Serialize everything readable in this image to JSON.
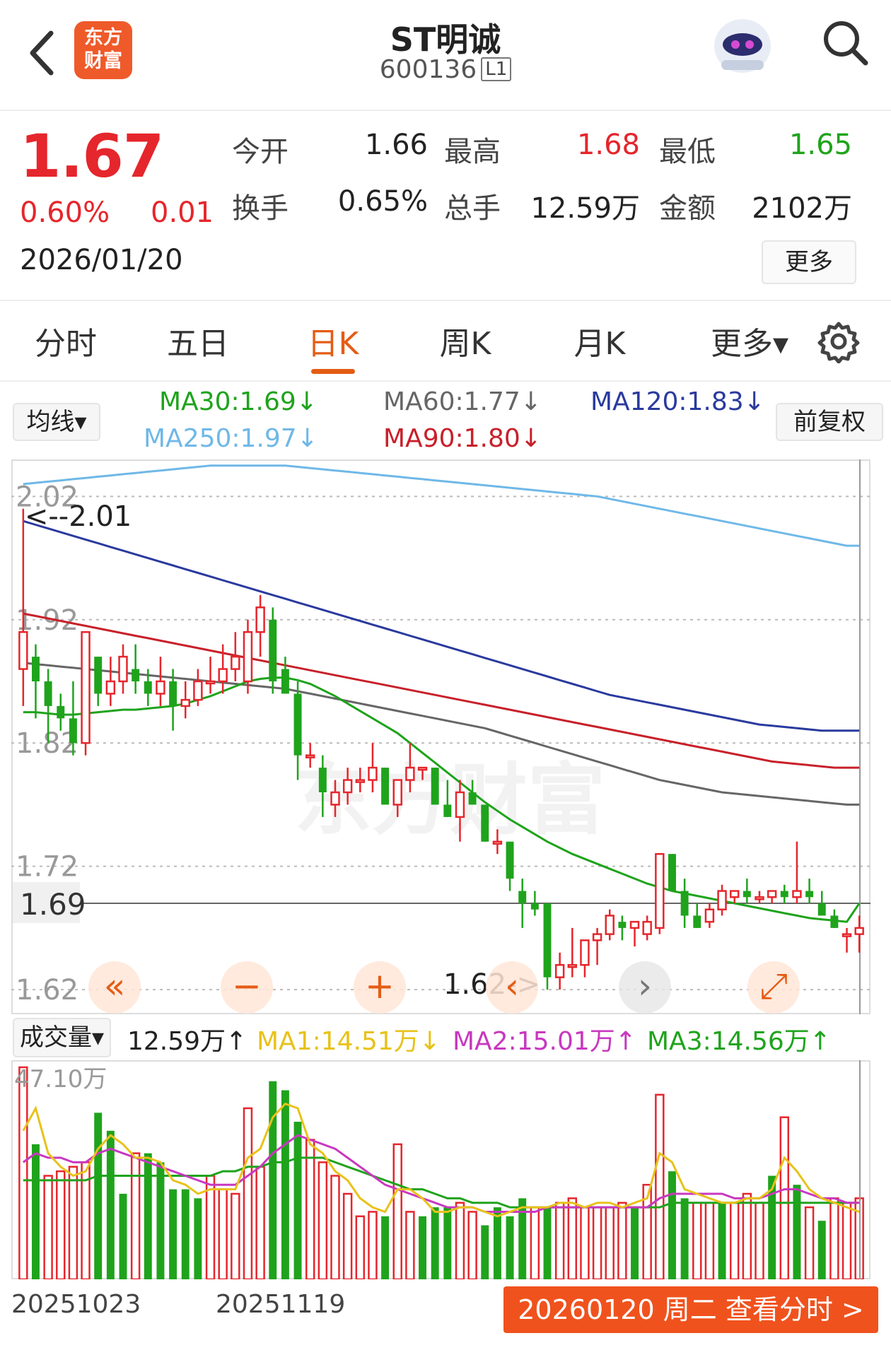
{
  "header": {
    "logo_text_line1": "东方",
    "logo_text_line2": "财富",
    "stock_name": "ST明诚",
    "stock_code": "600136",
    "level_badge": "L1"
  },
  "quote": {
    "price": "1.67",
    "change_pct": "0.60%",
    "change": "0.01",
    "date": "2026/01/20",
    "open_label": "今开",
    "open": "1.66",
    "high_label": "最高",
    "high": "1.68",
    "low_label": "最低",
    "low": "1.65",
    "turnover_label": "换手",
    "turnover": "0.65%",
    "volume_label": "总手",
    "volume": "12.59万",
    "amount_label": "金额",
    "amount": "2102万",
    "more_label": "更多"
  },
  "tabs": [
    {
      "label": "分时"
    },
    {
      "label": "五日"
    },
    {
      "label": "日K"
    },
    {
      "label": "周K"
    },
    {
      "label": "月K"
    },
    {
      "label": "更多▾"
    }
  ],
  "active_tab": "日K",
  "ma_legend": {
    "select_label": "均线▾",
    "adjust_label": "前复权",
    "ma30": "MA30:1.69↓",
    "ma60": "MA60:1.77↓",
    "ma120": "MA120:1.83↓",
    "ma250": "MA250:1.97↓",
    "ma90": "MA90:1.80↓"
  },
  "colors": {
    "up": "#e5262c",
    "down": "#1fa31c",
    "ma30": "#1fa31c",
    "ma60": "#666666",
    "ma120": "#2a3a9e",
    "ma250": "#6fb8e8",
    "ma90": "#c8202a",
    "vma1": "#e8c21a",
    "vma2": "#c838c0",
    "vma3": "#1fa31c",
    "accent": "#e45c15"
  },
  "kline_axis": {
    "ticks": [
      "2.02",
      "1.92",
      "1.82",
      "1.72",
      "1.62"
    ],
    "current_price_label": "1.69",
    "max_marker": "<--2.01",
    "min_marker": "1.62->"
  },
  "controls": [
    "«",
    "−",
    "+",
    "‹",
    "›",
    "⤢"
  ],
  "volume_legend": {
    "select_label": "成交量▾",
    "current": "12.59万↑",
    "ma1": "MA1:14.51万↓",
    "ma2": "MA2:15.01万↑",
    "ma3": "MA3:14.56万↑",
    "max_label": "47.10万"
  },
  "x_dates": [
    "20251023",
    "20251119"
  ],
  "fenshi_button": "20260120 周二 查看分时 >",
  "chart_data": {
    "type": "candlestick",
    "ylim": [
      1.6,
      2.05
    ],
    "candles": [
      {
        "o": 1.88,
        "h": 2.01,
        "l": 1.85,
        "c": 1.91
      },
      {
        "o": 1.89,
        "h": 1.9,
        "l": 1.84,
        "c": 1.87
      },
      {
        "o": 1.87,
        "h": 1.88,
        "l": 1.82,
        "c": 1.85
      },
      {
        "o": 1.85,
        "h": 1.86,
        "l": 1.83,
        "c": 1.84
      },
      {
        "o": 1.84,
        "h": 1.87,
        "l": 1.81,
        "c": 1.82
      },
      {
        "o": 1.82,
        "h": 1.91,
        "l": 1.81,
        "c": 1.91
      },
      {
        "o": 1.89,
        "h": 1.89,
        "l": 1.85,
        "c": 1.86
      },
      {
        "o": 1.86,
        "h": 1.89,
        "l": 1.85,
        "c": 1.87
      },
      {
        "o": 1.87,
        "h": 1.9,
        "l": 1.86,
        "c": 1.89
      },
      {
        "o": 1.88,
        "h": 1.9,
        "l": 1.86,
        "c": 1.87
      },
      {
        "o": 1.87,
        "h": 1.88,
        "l": 1.85,
        "c": 1.86
      },
      {
        "o": 1.86,
        "h": 1.89,
        "l": 1.85,
        "c": 1.87
      },
      {
        "o": 1.87,
        "h": 1.88,
        "l": 1.83,
        "c": 1.85
      },
      {
        "o": 1.85,
        "h": 1.87,
        "l": 1.84,
        "c": 1.855
      },
      {
        "o": 1.855,
        "h": 1.88,
        "l": 1.85,
        "c": 1.87
      },
      {
        "o": 1.87,
        "h": 1.89,
        "l": 1.86,
        "c": 1.87
      },
      {
        "o": 1.87,
        "h": 1.9,
        "l": 1.86,
        "c": 1.88
      },
      {
        "o": 1.88,
        "h": 1.91,
        "l": 1.87,
        "c": 1.89
      },
      {
        "o": 1.87,
        "h": 1.92,
        "l": 1.86,
        "c": 1.91
      },
      {
        "o": 1.91,
        "h": 1.94,
        "l": 1.89,
        "c": 1.93
      },
      {
        "o": 1.92,
        "h": 1.93,
        "l": 1.86,
        "c": 1.87
      },
      {
        "o": 1.88,
        "h": 1.89,
        "l": 1.86,
        "c": 1.86
      },
      {
        "o": 1.86,
        "h": 1.87,
        "l": 1.79,
        "c": 1.81
      },
      {
        "o": 1.81,
        "h": 1.82,
        "l": 1.8,
        "c": 1.81
      },
      {
        "o": 1.8,
        "h": 1.81,
        "l": 1.76,
        "c": 1.78
      },
      {
        "o": 1.77,
        "h": 1.79,
        "l": 1.76,
        "c": 1.78
      },
      {
        "o": 1.78,
        "h": 1.8,
        "l": 1.77,
        "c": 1.79
      },
      {
        "o": 1.79,
        "h": 1.8,
        "l": 1.78,
        "c": 1.79
      },
      {
        "o": 1.79,
        "h": 1.82,
        "l": 1.78,
        "c": 1.8
      },
      {
        "o": 1.8,
        "h": 1.8,
        "l": 1.77,
        "c": 1.77
      },
      {
        "o": 1.77,
        "h": 1.79,
        "l": 1.76,
        "c": 1.79
      },
      {
        "o": 1.79,
        "h": 1.82,
        "l": 1.78,
        "c": 1.8
      },
      {
        "o": 1.8,
        "h": 1.8,
        "l": 1.79,
        "c": 1.8
      },
      {
        "o": 1.8,
        "h": 1.8,
        "l": 1.77,
        "c": 1.77
      },
      {
        "o": 1.77,
        "h": 1.79,
        "l": 1.76,
        "c": 1.76
      },
      {
        "o": 1.76,
        "h": 1.79,
        "l": 1.74,
        "c": 1.78
      },
      {
        "o": 1.78,
        "h": 1.79,
        "l": 1.77,
        "c": 1.77
      },
      {
        "o": 1.77,
        "h": 1.77,
        "l": 1.74,
        "c": 1.74
      },
      {
        "o": 1.74,
        "h": 1.75,
        "l": 1.73,
        "c": 1.74
      },
      {
        "o": 1.74,
        "h": 1.74,
        "l": 1.7,
        "c": 1.71
      },
      {
        "o": 1.7,
        "h": 1.71,
        "l": 1.67,
        "c": 1.69
      },
      {
        "o": 1.69,
        "h": 1.7,
        "l": 1.68,
        "c": 1.685
      },
      {
        "o": 1.69,
        "h": 1.69,
        "l": 1.62,
        "c": 1.63
      },
      {
        "o": 1.63,
        "h": 1.65,
        "l": 1.62,
        "c": 1.64
      },
      {
        "o": 1.64,
        "h": 1.67,
        "l": 1.63,
        "c": 1.64
      },
      {
        "o": 1.64,
        "h": 1.66,
        "l": 1.63,
        "c": 1.66
      },
      {
        "o": 1.66,
        "h": 1.67,
        "l": 1.64,
        "c": 1.665
      },
      {
        "o": 1.665,
        "h": 1.685,
        "l": 1.66,
        "c": 1.68
      },
      {
        "o": 1.675,
        "h": 1.68,
        "l": 1.66,
        "c": 1.67
      },
      {
        "o": 1.67,
        "h": 1.675,
        "l": 1.655,
        "c": 1.675
      },
      {
        "o": 1.665,
        "h": 1.68,
        "l": 1.66,
        "c": 1.675
      },
      {
        "o": 1.67,
        "h": 1.73,
        "l": 1.665,
        "c": 1.73
      },
      {
        "o": 1.73,
        "h": 1.73,
        "l": 1.7,
        "c": 1.7
      },
      {
        "o": 1.7,
        "h": 1.71,
        "l": 1.67,
        "c": 1.68
      },
      {
        "o": 1.68,
        "h": 1.69,
        "l": 1.67,
        "c": 1.67
      },
      {
        "o": 1.675,
        "h": 1.69,
        "l": 1.67,
        "c": 1.685
      },
      {
        "o": 1.685,
        "h": 1.705,
        "l": 1.68,
        "c": 1.7
      },
      {
        "o": 1.695,
        "h": 1.7,
        "l": 1.69,
        "c": 1.7
      },
      {
        "o": 1.7,
        "h": 1.71,
        "l": 1.69,
        "c": 1.695
      },
      {
        "o": 1.695,
        "h": 1.7,
        "l": 1.69,
        "c": 1.695
      },
      {
        "o": 1.695,
        "h": 1.7,
        "l": 1.69,
        "c": 1.7
      },
      {
        "o": 1.7,
        "h": 1.705,
        "l": 1.69,
        "c": 1.695
      },
      {
        "o": 1.695,
        "h": 1.74,
        "l": 1.69,
        "c": 1.7
      },
      {
        "o": 1.7,
        "h": 1.71,
        "l": 1.69,
        "c": 1.695
      },
      {
        "o": 1.69,
        "h": 1.7,
        "l": 1.68,
        "c": 1.68
      },
      {
        "o": 1.68,
        "h": 1.685,
        "l": 1.67,
        "c": 1.67
      },
      {
        "o": 1.665,
        "h": 1.67,
        "l": 1.65,
        "c": 1.665
      },
      {
        "o": 1.665,
        "h": 1.68,
        "l": 1.65,
        "c": 1.67
      }
    ],
    "ma30": [
      1.845,
      1.845,
      1.844,
      1.843,
      1.843,
      1.844,
      1.845,
      1.846,
      1.847,
      1.847,
      1.848,
      1.849,
      1.85,
      1.852,
      1.855,
      1.858,
      1.862,
      1.866,
      1.87,
      1.872,
      1.873,
      1.873,
      1.871,
      1.868,
      1.863,
      1.858,
      1.852,
      1.846,
      1.84,
      1.834,
      1.828,
      1.82,
      1.812,
      1.804,
      1.796,
      1.788,
      1.78,
      1.772,
      1.765,
      1.758,
      1.752,
      1.746,
      1.74,
      1.735,
      1.73,
      1.726,
      1.722,
      1.718,
      1.714,
      1.71,
      1.706,
      1.703,
      1.7,
      1.698,
      1.696,
      1.694,
      1.692,
      1.69,
      1.688,
      1.686,
      1.684,
      1.682,
      1.68,
      1.678,
      1.677,
      1.676,
      1.675,
      1.69
    ],
    "ma60": [
      1.885,
      1.884,
      1.883,
      1.882,
      1.881,
      1.88,
      1.879,
      1.878,
      1.877,
      1.876,
      1.875,
      1.874,
      1.873,
      1.872,
      1.871,
      1.87,
      1.869,
      1.868,
      1.867,
      1.866,
      1.865,
      1.864,
      1.862,
      1.86,
      1.858,
      1.856,
      1.854,
      1.852,
      1.85,
      1.848,
      1.846,
      1.844,
      1.842,
      1.84,
      1.838,
      1.836,
      1.834,
      1.832,
      1.829,
      1.826,
      1.823,
      1.82,
      1.817,
      1.814,
      1.811,
      1.808,
      1.805,
      1.802,
      1.799,
      1.796,
      1.793,
      1.79,
      1.788,
      1.786,
      1.784,
      1.782,
      1.78,
      1.779,
      1.778,
      1.777,
      1.776,
      1.775,
      1.774,
      1.773,
      1.772,
      1.771,
      1.77,
      1.77
    ],
    "ma90": [
      1.925,
      1.923,
      1.921,
      1.919,
      1.917,
      1.915,
      1.913,
      1.911,
      1.909,
      1.907,
      1.905,
      1.903,
      1.901,
      1.899,
      1.897,
      1.895,
      1.893,
      1.891,
      1.889,
      1.887,
      1.885,
      1.883,
      1.881,
      1.879,
      1.877,
      1.875,
      1.873,
      1.871,
      1.869,
      1.867,
      1.865,
      1.863,
      1.861,
      1.859,
      1.857,
      1.855,
      1.853,
      1.851,
      1.849,
      1.847,
      1.845,
      1.843,
      1.841,
      1.839,
      1.837,
      1.835,
      1.833,
      1.831,
      1.829,
      1.827,
      1.825,
      1.823,
      1.821,
      1.819,
      1.817,
      1.815,
      1.813,
      1.811,
      1.809,
      1.807,
      1.805,
      1.804,
      1.803,
      1.802,
      1.801,
      1.8,
      1.8,
      1.8
    ],
    "ma120": [
      2.0,
      1.997,
      1.994,
      1.991,
      1.988,
      1.985,
      1.982,
      1.979,
      1.976,
      1.973,
      1.97,
      1.967,
      1.964,
      1.961,
      1.958,
      1.955,
      1.952,
      1.949,
      1.946,
      1.943,
      1.94,
      1.937,
      1.934,
      1.931,
      1.928,
      1.925,
      1.922,
      1.919,
      1.916,
      1.913,
      1.91,
      1.907,
      1.904,
      1.901,
      1.898,
      1.895,
      1.892,
      1.889,
      1.886,
      1.883,
      1.88,
      1.877,
      1.874,
      1.871,
      1.868,
      1.865,
      1.862,
      1.859,
      1.857,
      1.855,
      1.853,
      1.851,
      1.849,
      1.847,
      1.845,
      1.843,
      1.841,
      1.839,
      1.837,
      1.835,
      1.834,
      1.833,
      1.832,
      1.831,
      1.83,
      1.83,
      1.83,
      1.83
    ],
    "ma250": [
      2.03,
      2.031,
      2.032,
      2.033,
      2.034,
      2.035,
      2.036,
      2.037,
      2.038,
      2.039,
      2.04,
      2.041,
      2.042,
      2.043,
      2.044,
      2.045,
      2.045,
      2.045,
      2.045,
      2.045,
      2.045,
      2.045,
      2.044,
      2.043,
      2.042,
      2.041,
      2.04,
      2.039,
      2.038,
      2.037,
      2.036,
      2.035,
      2.034,
      2.033,
      2.032,
      2.031,
      2.03,
      2.029,
      2.028,
      2.027,
      2.026,
      2.025,
      2.024,
      2.023,
      2.022,
      2.021,
      2.02,
      2.018,
      2.016,
      2.014,
      2.012,
      2.01,
      2.008,
      2.006,
      2.004,
      2.002,
      2.0,
      1.998,
      1.996,
      1.994,
      1.992,
      1.99,
      1.988,
      1.986,
      1.984,
      1.982,
      1.98,
      1.98
    ],
    "volume": {
      "unit": "万",
      "ylim": [
        0,
        47.1
      ],
      "values": [
        47.1,
        30,
        23,
        24,
        25,
        26,
        37,
        33,
        19,
        28,
        28,
        26,
        20,
        20,
        18,
        23,
        20,
        19,
        38,
        25,
        44,
        42,
        35,
        31,
        26,
        23,
        19,
        14,
        15,
        14,
        30,
        15,
        14,
        16,
        16,
        17,
        15,
        12,
        16,
        14,
        18,
        16,
        16,
        17,
        18,
        16,
        16,
        16,
        17,
        16,
        21,
        41,
        24,
        18,
        17,
        17,
        17,
        17,
        19,
        17,
        23,
        36,
        21,
        16,
        13,
        18,
        17,
        18
      ],
      "up_flags": [
        1,
        0,
        1,
        1,
        1,
        1,
        0,
        0,
        0,
        1,
        0,
        0,
        0,
        0,
        0,
        1,
        1,
        1,
        1,
        1,
        0,
        0,
        0,
        1,
        1,
        1,
        1,
        1,
        1,
        0,
        1,
        1,
        0,
        0,
        0,
        1,
        1,
        0,
        0,
        0,
        0,
        1,
        0,
        1,
        1,
        1,
        1,
        1,
        1,
        0,
        1,
        1,
        0,
        0,
        1,
        1,
        0,
        1,
        1,
        1,
        0,
        1,
        0,
        1,
        0,
        1,
        1,
        1
      ],
      "ma1": [
        33,
        38,
        28,
        25,
        23,
        24,
        29,
        32,
        30,
        27,
        27,
        26,
        22,
        21,
        19,
        20,
        20,
        20,
        27,
        29,
        36,
        39,
        38,
        30,
        28,
        24,
        22,
        18,
        16,
        15,
        20,
        20,
        18,
        15,
        15,
        16,
        16,
        15,
        14,
        15,
        16,
        16,
        16,
        17,
        17,
        16,
        17,
        17,
        16,
        17,
        18,
        28,
        26,
        20,
        19,
        18,
        17,
        17,
        18,
        18,
        20,
        27,
        24,
        20,
        18,
        17,
        16,
        15
      ],
      "ma2": [
        26,
        28,
        27,
        27,
        26,
        26,
        28,
        29,
        28,
        27,
        26,
        25,
        24,
        23,
        22,
        21,
        21,
        21,
        23,
        25,
        28,
        30,
        32,
        31,
        30,
        29,
        27,
        25,
        23,
        21,
        20,
        19,
        18,
        17,
        16,
        16,
        16,
        15,
        15,
        15,
        15,
        15,
        16,
        16,
        16,
        16,
        16,
        16,
        16,
        16,
        16,
        18,
        19,
        19,
        19,
        19,
        19,
        18,
        18,
        18,
        19,
        20,
        20,
        19,
        18,
        18,
        17,
        17
      ],
      "ma3": [
        22,
        22,
        22,
        22,
        22,
        22,
        23,
        23,
        23,
        23,
        23,
        23,
        23,
        23,
        23,
        23,
        24,
        24,
        25,
        25,
        26,
        26,
        27,
        27,
        27,
        26,
        25,
        24,
        23,
        22,
        21,
        20,
        20,
        19,
        18,
        18,
        17,
        17,
        17,
        16,
        16,
        16,
        16,
        16,
        16,
        16,
        16,
        16,
        16,
        16,
        16,
        16,
        17,
        17,
        17,
        17,
        17,
        17,
        17,
        17,
        17,
        17,
        17,
        17,
        17,
        17,
        17,
        17
      ]
    }
  }
}
